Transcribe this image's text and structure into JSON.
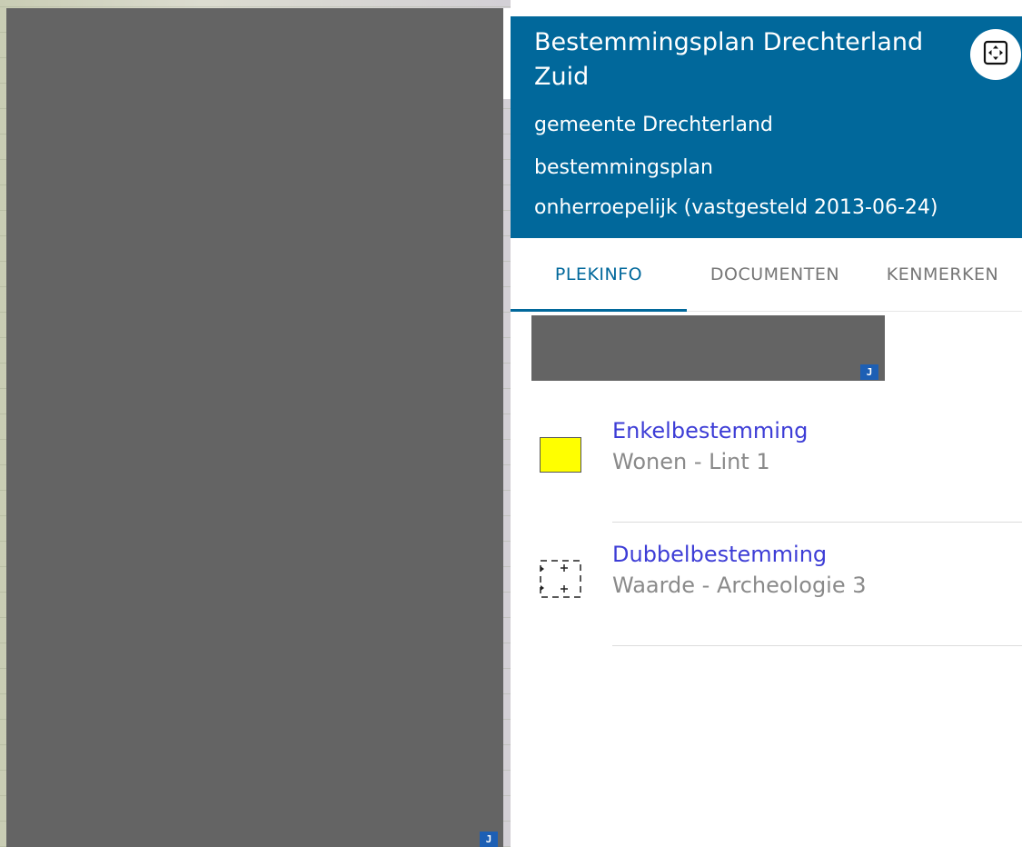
{
  "header": {
    "title": "Bestemmingsplan Drechterland Zuid",
    "municipality": "gemeente Drechterland",
    "plan_type": "bestemmingsplan",
    "status": "onherroepelijk (vastgesteld 2013-06-24)",
    "background_color": "#01689b",
    "expand_icon": "expand-arrows-icon"
  },
  "tabs": [
    {
      "label": "PLEKINFO",
      "active": true
    },
    {
      "label": "DOCUMENTEN",
      "active": false
    },
    {
      "label": "KENMERKEN",
      "active": false
    }
  ],
  "badges": {
    "map": "J",
    "panel": "J"
  },
  "items": [
    {
      "category": "Enkelbestemming",
      "value": "Wonen - Lint 1",
      "legend_color": "#ffff00",
      "legend_icon": "yellow-legend-swatch"
    },
    {
      "category": "Dubbelbestemming",
      "value": "Waarde - Archeologie 3",
      "legend_icon": "archeology-legend-swatch"
    }
  ],
  "colors": {
    "accent": "#01689b",
    "link": "#3d3dd6",
    "redacted": "#646464"
  }
}
